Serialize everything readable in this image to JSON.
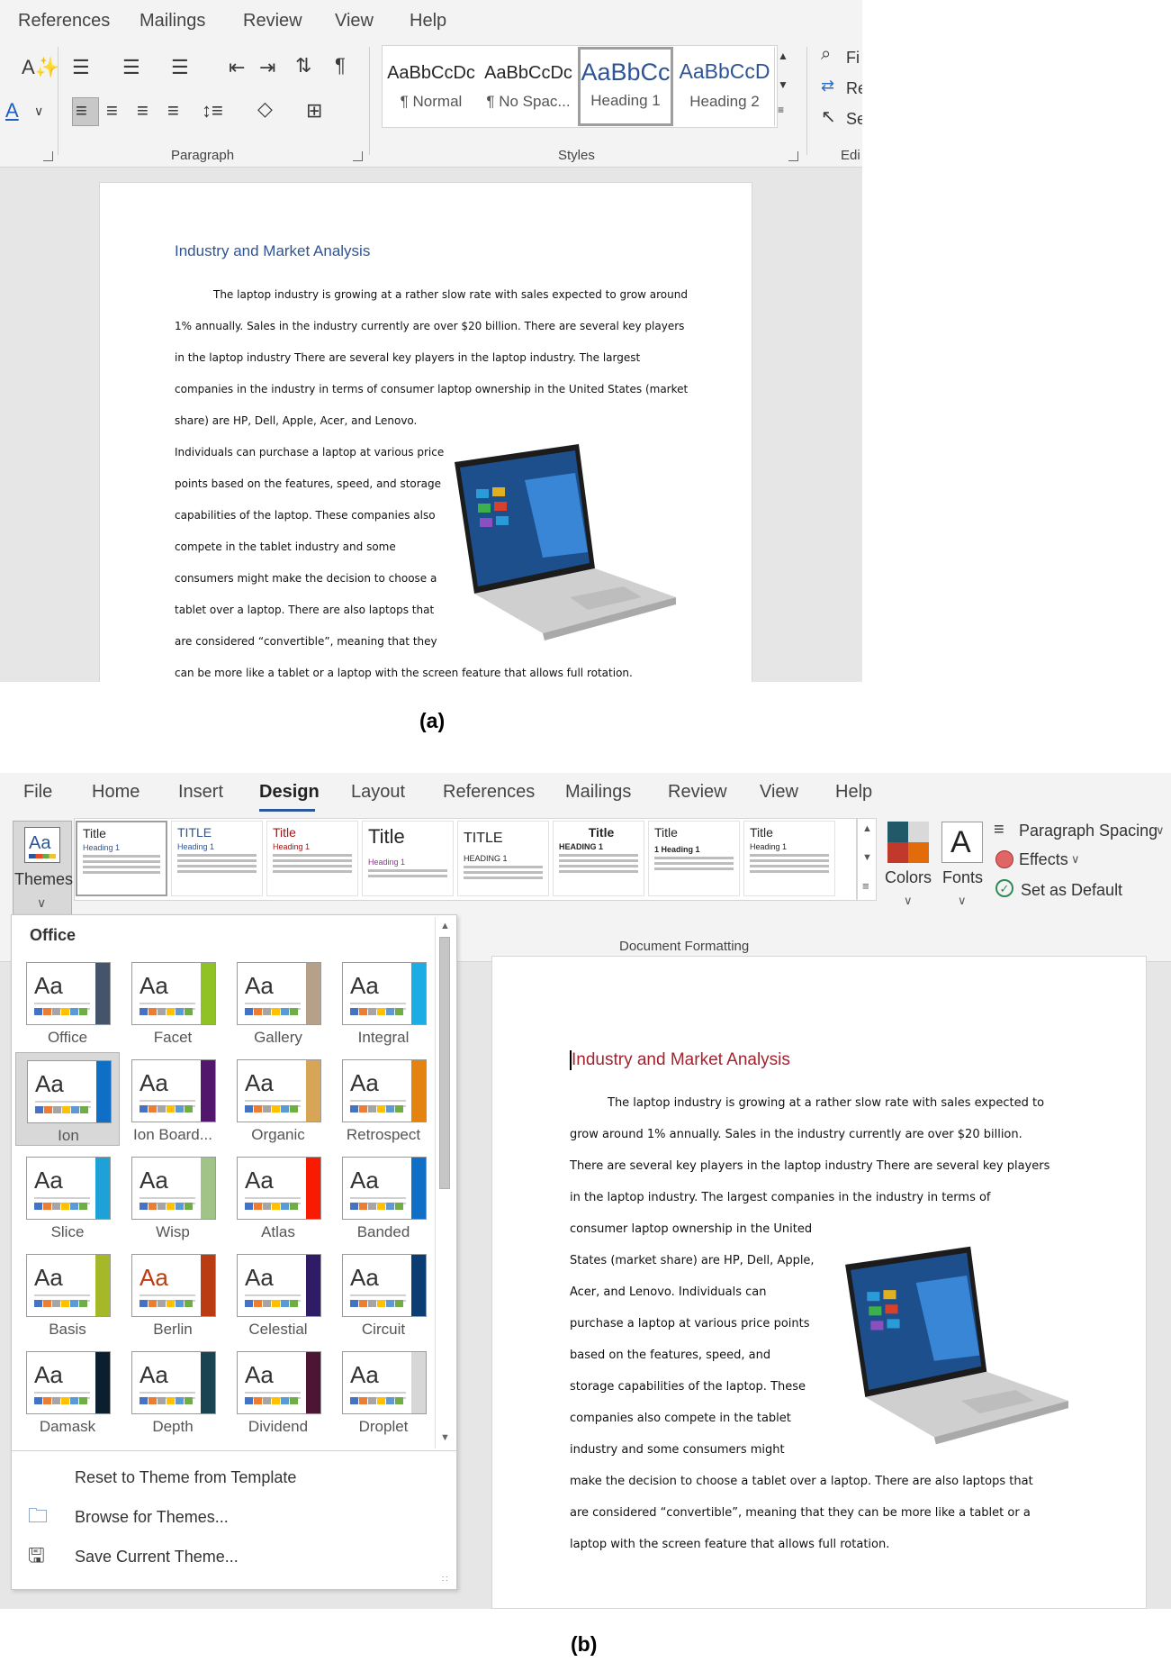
{
  "panelA": {
    "tabs": [
      "References",
      "Mailings",
      "Review",
      "View",
      "Help"
    ],
    "groups": {
      "paragraph": "Paragraph",
      "styles": "Styles",
      "editing": "Edi"
    },
    "styles": [
      {
        "preview": "AaBbCcDc",
        "name": "¶ Normal"
      },
      {
        "preview": "AaBbCcDc",
        "name": "¶ No Spac..."
      },
      {
        "preview": "AaBbCc",
        "name": "Heading 1"
      },
      {
        "preview": "AaBbCcD",
        "name": "Heading 2"
      }
    ],
    "editing": [
      "Fi",
      "Re",
      "Se"
    ],
    "document": {
      "title": "Industry and Market Analysis",
      "lines": [
        "The laptop industry is growing at a rather slow rate with sales expected to grow around",
        "1% annually.  Sales in the industry currently are over $20 billion.  There are several key players",
        "in the laptop industry There are several key players in the laptop industry.  The largest",
        "companies in the industry in terms of consumer laptop ownership in the United States (market",
        "share) are HP, Dell, Apple, Acer, and Lenovo.",
        "Individuals can purchase a laptop at various price",
        "points based on the features, speed, and storage",
        "capabilities of the laptop. These companies also",
        "compete in the tablet industry and some",
        "consumers might make the decision to choose a",
        "tablet over a laptop.  There are also laptops that",
        "are considered “convertible”, meaning that they",
        "can be more like a tablet or a laptop with the screen feature that allows full rotation."
      ]
    },
    "caption": "(a)"
  },
  "panelB": {
    "tabs": [
      "File",
      "Home",
      "Insert",
      "Design",
      "Layout",
      "References",
      "Mailings",
      "Review",
      "View",
      "Help"
    ],
    "active_tab": "Design",
    "themes_button": "Themes",
    "gallery": [
      {
        "title": "Title",
        "heading": "Heading 1"
      },
      {
        "title": "TITLE",
        "heading": "Heading 1"
      },
      {
        "title": "Title",
        "heading": "Heading 1"
      },
      {
        "title": "Title",
        "heading": "Heading 1"
      },
      {
        "title": "TITLE",
        "heading": "HEADING 1"
      },
      {
        "title": "Title",
        "heading": "HEADING 1"
      },
      {
        "title": "Title",
        "heading": "1 Heading 1"
      },
      {
        "title": "Title",
        "heading": "Heading 1"
      }
    ],
    "colors_label": "Colors",
    "fonts_label": "Fonts",
    "fonts_glyph": "A",
    "paragraph_spacing": "Paragraph Spacing",
    "effects": "Effects",
    "set_default": "Set as Default",
    "group_label": "Document Formatting",
    "pane": {
      "section": "Office",
      "themes": [
        {
          "name": "Office",
          "strip": "#44546a"
        },
        {
          "name": "Facet",
          "strip": "#90c226"
        },
        {
          "name": "Gallery",
          "strip": "#b7a089"
        },
        {
          "name": "Integral",
          "strip": "#1cade4"
        },
        {
          "name": "Ion",
          "strip": "#0f6fc6"
        },
        {
          "name": "Ion Board...",
          "strip": "#52176c"
        },
        {
          "name": "Organic",
          "strip": "#d7a555"
        },
        {
          "name": "Retrospect",
          "strip": "#e48312"
        },
        {
          "name": "Slice",
          "strip": "#1da1d6"
        },
        {
          "name": "Wisp",
          "strip": "#a1c387"
        },
        {
          "name": "Atlas",
          "strip": "#f81b02"
        },
        {
          "name": "Banded",
          "strip": "#0f6fc6"
        },
        {
          "name": "Basis",
          "strip": "#a6b727"
        },
        {
          "name": "Berlin",
          "strip": "#b93c12"
        },
        {
          "name": "Celestial",
          "strip": "#2f1b66"
        },
        {
          "name": "Circuit",
          "strip": "#0b3c72"
        },
        {
          "name": "Damask",
          "strip": "#0b1f2e"
        },
        {
          "name": "Depth",
          "strip": "#1a4452"
        },
        {
          "name": "Dividend",
          "strip": "#4d1434"
        },
        {
          "name": "Droplet",
          "strip": "#d7d7d7"
        }
      ],
      "selected": "Ion",
      "menu": [
        "Reset to Theme from Template",
        "Browse for Themes...",
        "Save Current Theme..."
      ]
    },
    "document": {
      "title": "Industry and Market Analysis",
      "lines": [
        "The laptop industry is growing at a rather slow rate with sales expected to",
        "grow around 1% annually.  Sales in the industry currently are over $20 billion.",
        "There are several key players in the laptop industry There are several key players",
        "in the laptop industry.  The largest companies in the industry in terms of",
        "consumer laptop ownership in the United",
        "States (market share) are HP, Dell, Apple,",
        "Acer, and Lenovo.  Individuals can",
        "purchase a laptop at various price points",
        "based on the features, speed, and",
        "storage capabilities of the laptop. These",
        "companies also compete in the tablet",
        "industry and some consumers might",
        "make the decision to choose a tablet over a laptop.  There are also laptops that",
        "are considered “convertible”, meaning that they can be more like a tablet or a",
        "laptop with the screen feature that allows full rotation."
      ]
    },
    "caption": "(b)"
  }
}
